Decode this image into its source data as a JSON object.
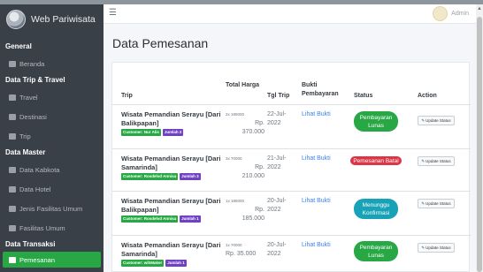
{
  "brand": {
    "name": "Web Pariwisata"
  },
  "user": {
    "name": "Admin"
  },
  "sidebar": {
    "sections": [
      {
        "heading": "General",
        "items": [
          {
            "label": "Beranda",
            "icon": "home-icon"
          }
        ]
      },
      {
        "heading": "Data Trip & Travel",
        "items": [
          {
            "label": "Travel",
            "icon": "car-icon"
          },
          {
            "label": "Destinasi",
            "icon": "destination-icon"
          },
          {
            "label": "Trip",
            "icon": "trip-icon"
          }
        ]
      },
      {
        "heading": "Data Master",
        "items": [
          {
            "label": "Data Kabkota",
            "icon": "building-icon"
          },
          {
            "label": "Data Hotel",
            "icon": "hotel-icon"
          },
          {
            "label": "Jenis Fasilitas Umum",
            "icon": "list-icon"
          },
          {
            "label": "Fasilitas Umum",
            "icon": "facility-icon"
          }
        ]
      },
      {
        "heading": "Data Transaksi",
        "items": [
          {
            "label": "Pemesanan",
            "icon": "cart-icon",
            "active": true
          }
        ]
      }
    ]
  },
  "page": {
    "title": "Data Pemesanan"
  },
  "table": {
    "headers": {
      "trip": "Trip",
      "harga": "Total Harga",
      "tgl": "Tgl Trip",
      "bukti": "Bukti Pembayaran",
      "status": "Status",
      "action": "Action"
    },
    "rows": [
      {
        "trip": "Wisata Pemandian Serayu [Dari Balikpapan]",
        "customer": "Customer: Nur Alis",
        "jumlah": "Jumlah 2",
        "qty": "2x 185000",
        "rp": "Rp.",
        "total": "370.000",
        "tgl": "22-Jul-2022",
        "bukti": "Lihat Bukti",
        "status": "Pembayaran Lunas",
        "status_color": "#28a745",
        "action": "Update Status"
      },
      {
        "trip": "Wisata Pemandian Serayu [Dari Samarinda]",
        "customer": "Customer: Rosdelvd Annisa",
        "jumlah": "Jumlah 3",
        "qty": "3x 70000",
        "rp": "Rp.",
        "total": "210.000",
        "tgl": "21-Jul-2022",
        "bukti": "Lihat Bukti",
        "status": "Pemesanan Batal",
        "status_color": "#dc3545",
        "action": "Update Status"
      },
      {
        "trip": "Wisata Pemandian Serayu [Dari Balikpapan]",
        "customer": "Customer: Rosdelvd Annisa",
        "jumlah": "Jumlah 1",
        "qty": "1x 185000",
        "rp": "Rp.",
        "total": "185.000",
        "tgl": "20-Jul-2022",
        "bukti": "Lihat Bukti",
        "status": "Menunggu Konfirmasi",
        "status_color": "#17a2b8",
        "action": "Update Status"
      },
      {
        "trip": "Wisata Pemandian Serayu [Dari Samarinda]",
        "customer": "Customer: wihMaker",
        "jumlah": "Jumlah 1",
        "qty": "1x 70000",
        "total": "Rp. 35.000",
        "tgl": "20-Jul-2022",
        "bukti": "Lihat Bukti",
        "status": "Pembayaran Lunas",
        "status_color": "#28a745",
        "action": "Update Status"
      }
    ]
  }
}
